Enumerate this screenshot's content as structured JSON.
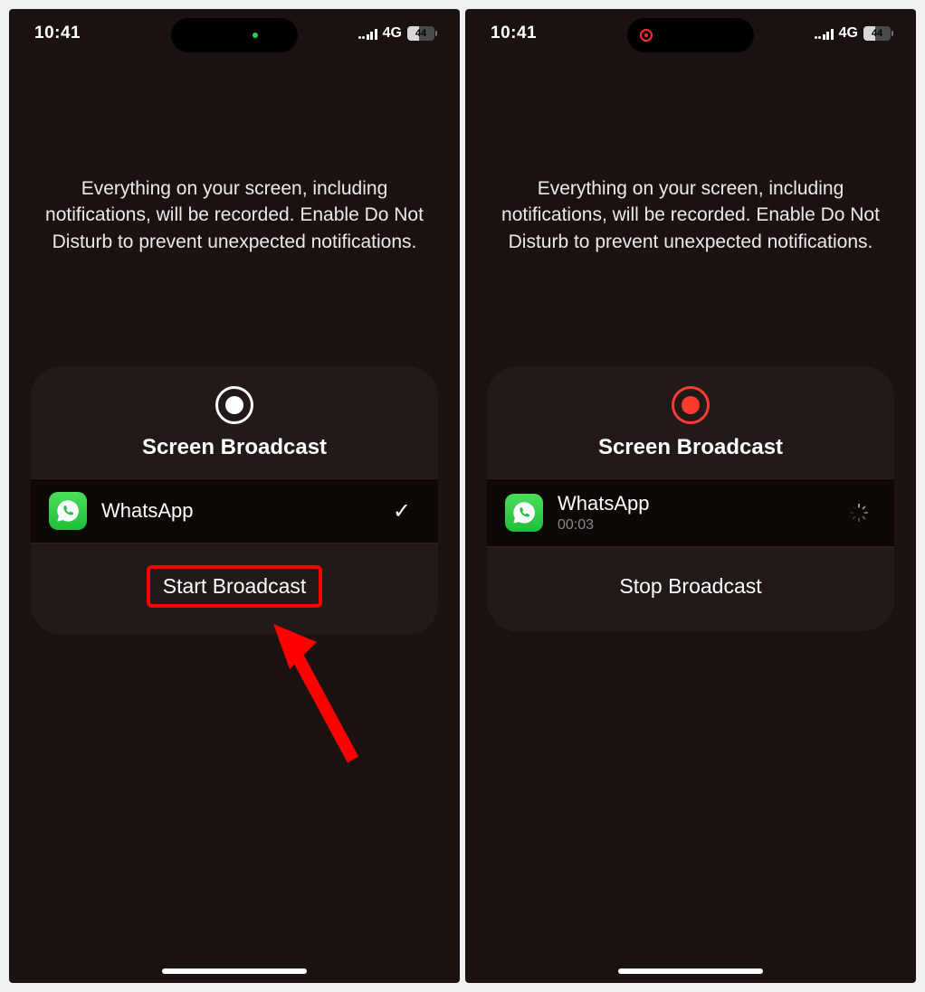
{
  "left": {
    "status": {
      "time": "10:41",
      "network": "4G",
      "battery": "44"
    },
    "info": "Everything on your screen, including notifications, will be recorded. Enable Do Not Disturb to prevent unexpected notifications.",
    "card": {
      "title": "Screen Broadcast",
      "app": {
        "name": "WhatsApp"
      },
      "action": "Start Broadcast"
    }
  },
  "right": {
    "status": {
      "time": "10:41",
      "network": "4G",
      "battery": "44"
    },
    "info": "Everything on your screen, including notifications, will be recorded. Enable Do Not Disturb to prevent unexpected notifications.",
    "card": {
      "title": "Screen Broadcast",
      "app": {
        "name": "WhatsApp",
        "timer": "00:03"
      },
      "action": "Stop Broadcast"
    }
  }
}
